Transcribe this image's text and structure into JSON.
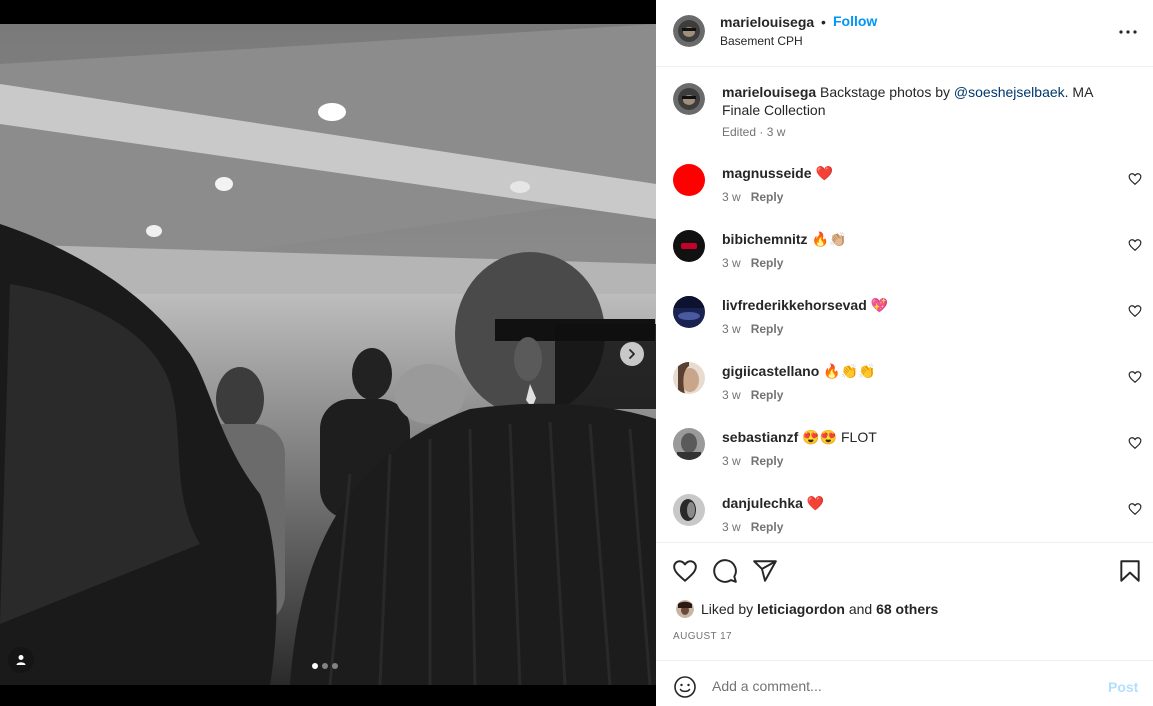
{
  "post": {
    "username": "marielouisega",
    "follow_label": "Follow",
    "bullet": "•",
    "location": "Basement CPH",
    "caption": {
      "username": "marielouisega",
      "text_before": " Backstage photos by ",
      "mention": "@soeshejselbaek",
      "text_after": ". MA Finale Collection",
      "meta": "Edited · 3 w"
    }
  },
  "comments": [
    {
      "username": "magnusseide",
      "text": "❤️",
      "time": "3 w",
      "reply": "Reply",
      "avatar_color": "#ff0000"
    },
    {
      "username": "bibichemnitz",
      "text": "🔥👏🏼",
      "time": "3 w",
      "reply": "Reply",
      "avatar_color": "#111111"
    },
    {
      "username": "livfrederikkehorsevad",
      "text": "💖",
      "time": "3 w",
      "reply": "Reply",
      "avatar_color": "#1a2350"
    },
    {
      "username": "gigiicastellano",
      "text": "🔥👏👏",
      "time": "3 w",
      "reply": "Reply",
      "avatar_color": "#c9a58c"
    },
    {
      "username": "sebastianzf",
      "text": "😍😍 FLOT",
      "time": "3 w",
      "reply": "Reply",
      "avatar_color": "#6a6a6a"
    },
    {
      "username": "danjulechka",
      "text": "❤️",
      "time": "3 w",
      "reply": "Reply",
      "avatar_color": "#3a3a3a"
    }
  ],
  "likes": {
    "prefix": "Liked by ",
    "user": "leticiagordon",
    "middle": " and ",
    "others": "68 others"
  },
  "date": "AUGUST 17",
  "comment_box": {
    "placeholder": "Add a comment...",
    "post_label": "Post"
  },
  "carousel": {
    "count": 3,
    "active": 1
  },
  "icons": {
    "next": "chevron-right-icon",
    "tag": "user-tag-icon",
    "more": "more-horizontal-icon",
    "like": "heart-icon",
    "comment": "comment-icon",
    "share": "share-icon",
    "save": "bookmark-icon",
    "emoji": "emoji-icon"
  },
  "colors": {
    "accent": "#0095f6",
    "post_disabled": "#b2dffc",
    "mention": "#00376b",
    "muted": "#737373"
  }
}
